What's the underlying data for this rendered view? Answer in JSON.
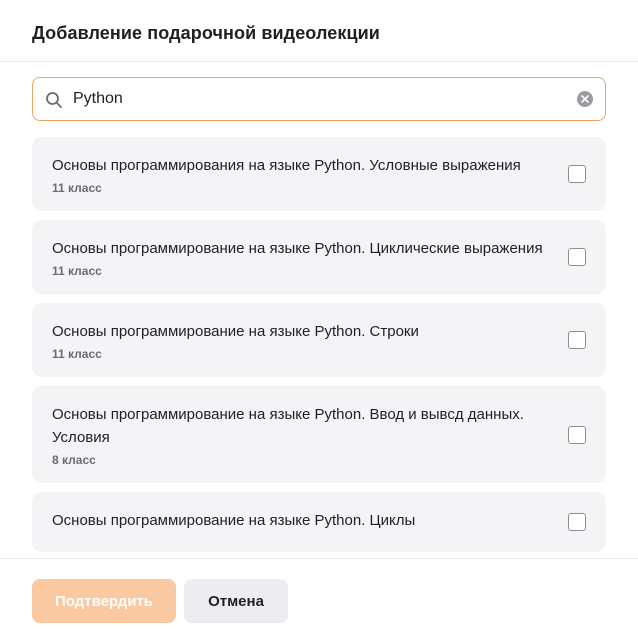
{
  "dialog": {
    "title": "Добавление подарочной видеолекции"
  },
  "search": {
    "value": "Python",
    "placeholder": "",
    "icon": "search-icon",
    "clear_icon": "clear-icon"
  },
  "items": [
    {
      "title": "Основы программирования на языке Python. Условные выражения",
      "grade": "11 класс",
      "checked": false
    },
    {
      "title": "Основы программирование на языке Python. Циклические выражения",
      "grade": "11 класс",
      "checked": false
    },
    {
      "title": "Основы программирование на языке Python. Строки",
      "grade": "11 класс",
      "checked": false
    },
    {
      "title": "Основы программирование на языке Python. Ввод и вывсд данных. Условия",
      "grade": "8 класс",
      "checked": false
    },
    {
      "title": "Основы программирование на языке Python. Циклы",
      "grade": "",
      "checked": false
    }
  ],
  "footer": {
    "confirm_label": "Подтвердить",
    "cancel_label": "Отмена"
  },
  "colors": {
    "accent": "#f0a360",
    "confirm_disabled": "#fbc9a1",
    "item_bg": "#f4f4f7"
  }
}
